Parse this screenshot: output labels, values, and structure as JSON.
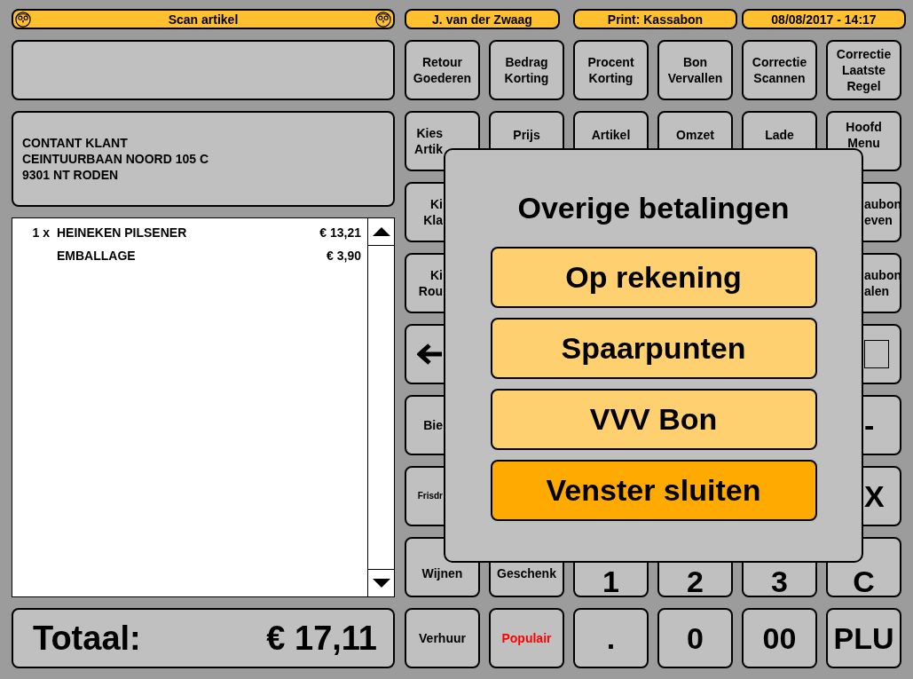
{
  "scan_bar": {
    "title": "Scan artikel"
  },
  "header": [
    {
      "text": "J. van der Zwaag"
    },
    {
      "text": "Print: Kassabon"
    },
    {
      "text": "08/08/2017 - 14:17"
    }
  ],
  "customer": [
    "CONTANT KLANT",
    "CEINTUURBAAN NOORD 105 C",
    "9301 NT RODEN"
  ],
  "receipt": [
    {
      "qty": "1 x",
      "name": "HEINEKEN PILSENER",
      "price": "€ 13,21"
    },
    {
      "name": "EMBALLAGE",
      "price": "€ 3,90"
    }
  ],
  "total": {
    "label": "Totaal:",
    "amount": "€ 17,11"
  },
  "key_rows": [
    [
      {
        "kind": "key",
        "lines": [
          "Retour",
          "Goederen"
        ]
      },
      {
        "kind": "key",
        "lines": [
          "Bedrag",
          "Korting"
        ]
      },
      {
        "kind": "key",
        "lines": [
          "Procent",
          "Korting"
        ]
      },
      {
        "kind": "key",
        "lines": [
          "Bon",
          "Vervallen"
        ]
      },
      {
        "kind": "key",
        "lines": [
          "Correctie",
          "Scannen"
        ]
      },
      {
        "kind": "key",
        "lines": [
          "Correctie",
          "Laatste",
          "Regel"
        ]
      }
    ],
    [
      {
        "kind": "left-clipped",
        "lines": [
          "Kies",
          "Artik"
        ]
      },
      {
        "kind": "top",
        "lines": [
          "Prijs"
        ]
      },
      {
        "kind": "top",
        "lines": [
          "Artikel"
        ]
      },
      {
        "kind": "top",
        "lines": [
          "Omzet"
        ]
      },
      {
        "kind": "top",
        "lines": [
          "Lade"
        ]
      },
      {
        "kind": "high",
        "lines": [
          "Hoofd",
          "Menu"
        ]
      }
    ],
    [
      {
        "kind": "left-clipped",
        "lines": [
          "Ki",
          "Kla"
        ]
      },
      {
        "kind": "right-clipped",
        "lines": [
          "aubon",
          "even"
        ]
      }
    ],
    [
      {
        "kind": "left-clipped",
        "lines": [
          "Ki",
          "Rou"
        ]
      },
      {
        "kind": "right-clipped",
        "lines": [
          "aubon",
          "alen"
        ]
      }
    ],
    [
      {
        "kind": "arrow-key"
      },
      {
        "kind": "box-key"
      }
    ],
    [
      {
        "kind": "left-clipped",
        "lines": [
          "Bie"
        ]
      },
      {
        "kind": "big-right-clipped",
        "lines": [
          "-"
        ]
      }
    ],
    [
      {
        "kind": "small-left-clipped",
        "lines": [
          "Frisdr"
        ]
      },
      {
        "kind": "big-right-clipped",
        "lines": [
          "X"
        ]
      }
    ],
    [
      {
        "kind": "bottom",
        "lines": [
          "Wijnen"
        ]
      },
      {
        "kind": "bottom",
        "lines": [
          "Geschenk"
        ]
      },
      {
        "kind": "big-bottom",
        "lines": [
          "1"
        ]
      },
      {
        "kind": "big-bottom",
        "lines": [
          "2"
        ]
      },
      {
        "kind": "big-bottom",
        "lines": [
          "3"
        ]
      },
      {
        "kind": "big-bottom",
        "lines": [
          "C"
        ]
      }
    ],
    [
      {
        "kind": "key",
        "lines": [
          "Verhuur"
        ]
      },
      {
        "kind": "key",
        "color": "#ff0000",
        "lines": [
          "Populair"
        ]
      },
      {
        "kind": "big-key",
        "lines": [
          "."
        ]
      },
      {
        "kind": "big-key",
        "lines": [
          "0"
        ]
      },
      {
        "kind": "big-key",
        "lines": [
          "00"
        ]
      },
      {
        "kind": "big-key",
        "lines": [
          "PLU"
        ]
      }
    ]
  ],
  "dialog": {
    "title": "Overige betalingen",
    "buttons": [
      {
        "kind": "option",
        "label": "Op rekening"
      },
      {
        "kind": "option",
        "label": "Spaarpunten"
      },
      {
        "kind": "option",
        "label": "VVV Bon"
      },
      {
        "kind": "close",
        "label": "Venster sluiten"
      }
    ]
  }
}
